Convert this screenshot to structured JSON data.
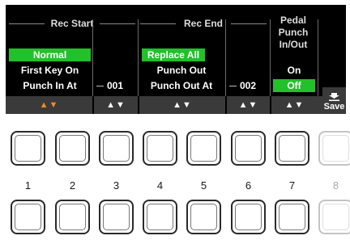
{
  "screen": {
    "rec_start": {
      "title": "Rec Start",
      "options": [
        "Normal",
        "First Key On",
        "Punch In At"
      ],
      "selected": "Normal",
      "measure": "001"
    },
    "rec_end": {
      "title": "Rec End",
      "options": [
        "Replace All",
        "Punch Out",
        "Punch Out At"
      ],
      "selected": "Replace All",
      "measure": "002"
    },
    "pedal": {
      "title_lines": [
        "Pedal",
        "Punch",
        "In/Out"
      ],
      "options": [
        "On",
        "Off"
      ],
      "selected": "Off"
    },
    "updown_glyph": "▲▼",
    "save": {
      "label": "Save",
      "icon": "save-download-icon"
    },
    "colors": {
      "selected": "#22c02a",
      "active_arrow": "#f08a24"
    }
  },
  "buttons": {
    "labels": [
      "1",
      "2",
      "3",
      "4",
      "5",
      "6",
      "7",
      "8"
    ]
  }
}
